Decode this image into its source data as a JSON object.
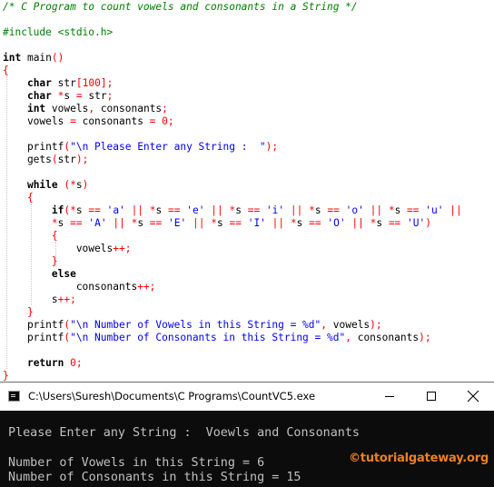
{
  "editor": {
    "lines": [
      [
        {
          "t": "cm",
          "v": "/* C Program to count vowels and consonants in a String */"
        }
      ],
      [],
      [
        {
          "t": "pp",
          "v": "#include <stdio.h>"
        }
      ],
      [],
      [
        {
          "t": "kw",
          "v": "int"
        },
        {
          "t": "id",
          "v": " main"
        },
        {
          "t": "br",
          "v": "()"
        }
      ],
      [
        {
          "t": "br",
          "v": "{"
        }
      ],
      [
        {
          "t": "id",
          "v": "    "
        },
        {
          "t": "kw",
          "v": "char"
        },
        {
          "t": "id",
          "v": " str"
        },
        {
          "t": "br",
          "v": "["
        },
        {
          "t": "num",
          "v": "100"
        },
        {
          "t": "br",
          "v": "]"
        },
        {
          "t": "op",
          "v": ";"
        }
      ],
      [
        {
          "t": "id",
          "v": "    "
        },
        {
          "t": "kw",
          "v": "char"
        },
        {
          "t": "id",
          "v": " "
        },
        {
          "t": "op",
          "v": "*"
        },
        {
          "t": "id",
          "v": "s "
        },
        {
          "t": "op",
          "v": "="
        },
        {
          "t": "id",
          "v": " str"
        },
        {
          "t": "op",
          "v": ";"
        }
      ],
      [
        {
          "t": "id",
          "v": "    "
        },
        {
          "t": "kw",
          "v": "int"
        },
        {
          "t": "id",
          "v": " vowels"
        },
        {
          "t": "op",
          "v": ","
        },
        {
          "t": "id",
          "v": " consonants"
        },
        {
          "t": "op",
          "v": ";"
        }
      ],
      [
        {
          "t": "id",
          "v": "    vowels "
        },
        {
          "t": "op",
          "v": "="
        },
        {
          "t": "id",
          "v": " consonants "
        },
        {
          "t": "op",
          "v": "="
        },
        {
          "t": "id",
          "v": " "
        },
        {
          "t": "num",
          "v": "0"
        },
        {
          "t": "op",
          "v": ";"
        }
      ],
      [],
      [
        {
          "t": "id",
          "v": "    printf"
        },
        {
          "t": "br",
          "v": "("
        },
        {
          "t": "str",
          "v": "\"\\n Please Enter any String :  \""
        },
        {
          "t": "br",
          "v": ")"
        },
        {
          "t": "op",
          "v": ";"
        }
      ],
      [
        {
          "t": "id",
          "v": "    gets"
        },
        {
          "t": "br",
          "v": "("
        },
        {
          "t": "id",
          "v": "str"
        },
        {
          "t": "br",
          "v": ")"
        },
        {
          "t": "op",
          "v": ";"
        }
      ],
      [],
      [
        {
          "t": "id",
          "v": "    "
        },
        {
          "t": "kw",
          "v": "while"
        },
        {
          "t": "id",
          "v": " "
        },
        {
          "t": "br",
          "v": "("
        },
        {
          "t": "op",
          "v": "*"
        },
        {
          "t": "id",
          "v": "s"
        },
        {
          "t": "br",
          "v": ")"
        }
      ],
      [
        {
          "t": "id",
          "v": "    "
        },
        {
          "t": "br",
          "v": "{"
        }
      ],
      [
        {
          "t": "id",
          "v": "        "
        },
        {
          "t": "kw",
          "v": "if"
        },
        {
          "t": "br",
          "v": "("
        },
        {
          "t": "op",
          "v": "*"
        },
        {
          "t": "id",
          "v": "s "
        },
        {
          "t": "op",
          "v": "=="
        },
        {
          "t": "id",
          "v": " "
        },
        {
          "t": "str",
          "v": "'a'"
        },
        {
          "t": "id",
          "v": " "
        },
        {
          "t": "op",
          "v": "||"
        },
        {
          "t": "id",
          "v": " "
        },
        {
          "t": "op",
          "v": "*"
        },
        {
          "t": "id",
          "v": "s "
        },
        {
          "t": "op",
          "v": "=="
        },
        {
          "t": "id",
          "v": " "
        },
        {
          "t": "str",
          "v": "'e'"
        },
        {
          "t": "id",
          "v": " "
        },
        {
          "t": "op",
          "v": "||"
        },
        {
          "t": "id",
          "v": " "
        },
        {
          "t": "op",
          "v": "*"
        },
        {
          "t": "id",
          "v": "s "
        },
        {
          "t": "op",
          "v": "=="
        },
        {
          "t": "id",
          "v": " "
        },
        {
          "t": "str",
          "v": "'i'"
        },
        {
          "t": "id",
          "v": " "
        },
        {
          "t": "op",
          "v": "||"
        },
        {
          "t": "id",
          "v": " "
        },
        {
          "t": "op",
          "v": "*"
        },
        {
          "t": "id",
          "v": "s "
        },
        {
          "t": "op",
          "v": "=="
        },
        {
          "t": "id",
          "v": " "
        },
        {
          "t": "str",
          "v": "'o'"
        },
        {
          "t": "id",
          "v": " "
        },
        {
          "t": "op",
          "v": "||"
        },
        {
          "t": "id",
          "v": " "
        },
        {
          "t": "op",
          "v": "*"
        },
        {
          "t": "id",
          "v": "s "
        },
        {
          "t": "op",
          "v": "=="
        },
        {
          "t": "id",
          "v": " "
        },
        {
          "t": "str",
          "v": "'u'"
        },
        {
          "t": "id",
          "v": " "
        },
        {
          "t": "op",
          "v": "||"
        }
      ],
      [
        {
          "t": "id",
          "v": "        "
        },
        {
          "t": "op",
          "v": "*"
        },
        {
          "t": "id",
          "v": "s "
        },
        {
          "t": "op",
          "v": "=="
        },
        {
          "t": "id",
          "v": " "
        },
        {
          "t": "str",
          "v": "'A'"
        },
        {
          "t": "id",
          "v": " "
        },
        {
          "t": "op",
          "v": "||"
        },
        {
          "t": "id",
          "v": " "
        },
        {
          "t": "op",
          "v": "*"
        },
        {
          "t": "id",
          "v": "s "
        },
        {
          "t": "op",
          "v": "=="
        },
        {
          "t": "id",
          "v": " "
        },
        {
          "t": "str",
          "v": "'E'"
        },
        {
          "t": "id",
          "v": " "
        },
        {
          "t": "op",
          "v": "||"
        },
        {
          "t": "id",
          "v": " "
        },
        {
          "t": "op",
          "v": "*"
        },
        {
          "t": "id",
          "v": "s "
        },
        {
          "t": "op",
          "v": "=="
        },
        {
          "t": "id",
          "v": " "
        },
        {
          "t": "str",
          "v": "'I'"
        },
        {
          "t": "id",
          "v": " "
        },
        {
          "t": "op",
          "v": "||"
        },
        {
          "t": "id",
          "v": " "
        },
        {
          "t": "op",
          "v": "*"
        },
        {
          "t": "id",
          "v": "s "
        },
        {
          "t": "op",
          "v": "=="
        },
        {
          "t": "id",
          "v": " "
        },
        {
          "t": "str",
          "v": "'O'"
        },
        {
          "t": "id",
          "v": " "
        },
        {
          "t": "op",
          "v": "||"
        },
        {
          "t": "id",
          "v": " "
        },
        {
          "t": "op",
          "v": "*"
        },
        {
          "t": "id",
          "v": "s "
        },
        {
          "t": "op",
          "v": "=="
        },
        {
          "t": "id",
          "v": " "
        },
        {
          "t": "str",
          "v": "'U'"
        },
        {
          "t": "br",
          "v": ")"
        }
      ],
      [
        {
          "t": "id",
          "v": "        "
        },
        {
          "t": "br",
          "v": "{"
        }
      ],
      [
        {
          "t": "id",
          "v": "            vowels"
        },
        {
          "t": "op",
          "v": "++;"
        }
      ],
      [
        {
          "t": "id",
          "v": "        "
        },
        {
          "t": "br",
          "v": "}"
        }
      ],
      [
        {
          "t": "id",
          "v": "        "
        },
        {
          "t": "kw",
          "v": "else"
        }
      ],
      [
        {
          "t": "id",
          "v": "            consonants"
        },
        {
          "t": "op",
          "v": "++;"
        }
      ],
      [
        {
          "t": "id",
          "v": "        s"
        },
        {
          "t": "op",
          "v": "++;"
        }
      ],
      [
        {
          "t": "id",
          "v": "    "
        },
        {
          "t": "br",
          "v": "}"
        }
      ],
      [
        {
          "t": "id",
          "v": "    printf"
        },
        {
          "t": "br",
          "v": "("
        },
        {
          "t": "str",
          "v": "\"\\n Number of Vowels in this String = %d\""
        },
        {
          "t": "op",
          "v": ","
        },
        {
          "t": "id",
          "v": " vowels"
        },
        {
          "t": "br",
          "v": ")"
        },
        {
          "t": "op",
          "v": ";"
        }
      ],
      [
        {
          "t": "id",
          "v": "    printf"
        },
        {
          "t": "br",
          "v": "("
        },
        {
          "t": "str",
          "v": "\"\\n Number of Consonants in this String = %d\""
        },
        {
          "t": "op",
          "v": ","
        },
        {
          "t": "id",
          "v": " consonants"
        },
        {
          "t": "br",
          "v": ")"
        },
        {
          "t": "op",
          "v": ";"
        }
      ],
      [],
      [
        {
          "t": "id",
          "v": "    "
        },
        {
          "t": "kw",
          "v": "return"
        },
        {
          "t": "id",
          "v": " "
        },
        {
          "t": "num",
          "v": "0"
        },
        {
          "t": "op",
          "v": ";"
        }
      ],
      [
        {
          "t": "br",
          "v": "}"
        }
      ]
    ]
  },
  "console": {
    "title": "C:\\Users\\Suresh\\Documents\\C Programs\\CountVC5.exe",
    "output": {
      "prompt_line": "Please Enter any String :  Voewls and Consonants",
      "vowels_line": "Number of Vowels in this String = 6",
      "consonants_line": "Number of Consonants in this String = 15"
    },
    "watermark": "©tutorialgateway.org"
  },
  "colors": {
    "comment": "#008000",
    "string": "#0000ff",
    "operator": "#ff0000",
    "console_bg": "#0c0c0c",
    "console_text": "#c0c0c0",
    "watermark": "#f07f1f"
  },
  "icons": {
    "app": "console-app-icon",
    "minimize": "minimize-icon",
    "maximize": "maximize-icon",
    "close": "close-icon"
  }
}
